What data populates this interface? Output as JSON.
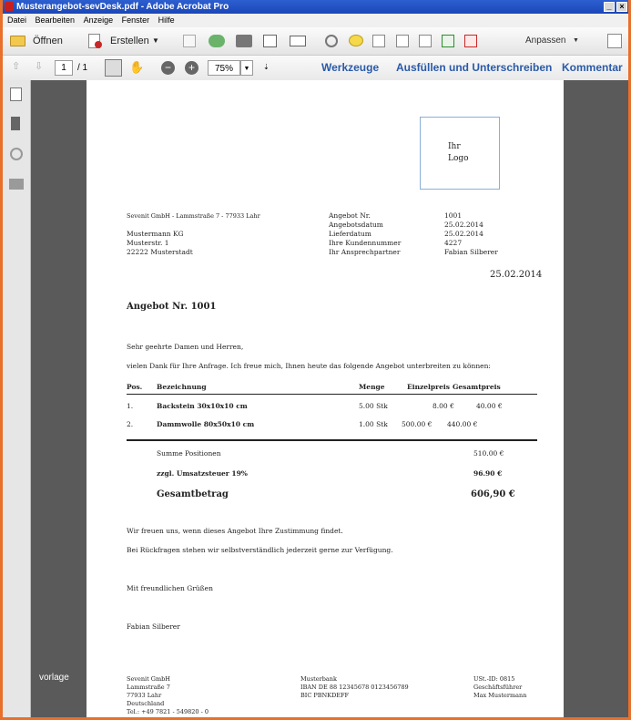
{
  "window": {
    "title": "Musterangebot-sevDesk.pdf - Adobe Acrobat Pro"
  },
  "menu": [
    "Datei",
    "Bearbeiten",
    "Anzeige",
    "Fenster",
    "Hilfe"
  ],
  "toolbar": {
    "open_label": "Öffnen",
    "create_label": "Erstellen",
    "customize_label": "Anpassen"
  },
  "nav": {
    "page_current": "1",
    "page_total": "/ 1",
    "zoom": "75%"
  },
  "panels": {
    "tools": "Werkzeuge",
    "fill_sign": "Ausfüllen und Unterschreiben",
    "comment": "Kommentar"
  },
  "doc": {
    "logo_line1": "Ihr",
    "logo_line2": "Logo",
    "sender_line": "Sevenit GmbH - Lammstraße 7 - 77933 Lahr",
    "recipient": [
      "Mustermann KG",
      "Musterstr. 1",
      "22222 Musterstadt"
    ],
    "meta_labels": [
      "Angebot Nr.",
      "Angebotsdatum",
      "Lieferdatum",
      "Ihre Kundennummer",
      "Ihr Ansprechpartner"
    ],
    "meta_values": [
      "1001",
      "25.02.2014",
      "25.02.2014",
      "4227",
      "Fabian Silberer"
    ],
    "date": "25.02.2014",
    "heading": "Angebot Nr. 1001",
    "greeting": "Sehr geehrte Damen und Herren,",
    "intro": "vielen Dank für Ihre Anfrage. Ich freue mich, Ihnen heute das folgende Angebot unterbreiten zu können:",
    "table_headers": {
      "pos": "Pos.",
      "desc": "Bezeichnung",
      "qty": "Menge",
      "unit": "Einzelpreis",
      "total": "Gesamtpreis"
    },
    "rows": [
      {
        "pos": "1.",
        "desc": "Backstein 30x10x10 cm",
        "qty": "5.00 Stk",
        "unit": "8.00 €",
        "total": "40.00 €"
      },
      {
        "pos": "2.",
        "desc": "Dammwolle 80x50x10 cm",
        "qty": "1.00 Stk",
        "unit": "500.00 €",
        "total": "440.00 €"
      }
    ],
    "sum_label": "Summe Positionen",
    "sum_value": "510.00 €",
    "vat_label": "zzgl. Umsatzsteuer 19%",
    "vat_value": "96.90 €",
    "grand_label": "Gesamtbetrag",
    "grand_value": "606,90 €",
    "closing1": "Wir freuen uns, wenn dieses Angebot Ihre Zustimmung findet.",
    "closing2": "Bei Rückfragen stehen wir selbstverständlich jederzeit gerne zur Verfügung.",
    "regards": "Mit freundlichen Grüßen",
    "signer": "Fabian Silberer",
    "footer_col1": [
      "Sevenit GmbH",
      "Lammstraße 7",
      "77933 Lahr",
      "Deutschland",
      "Tel.: +49 7821 - 549820 - 0"
    ],
    "footer_col2": [
      "Musterbank",
      "IBAN DE 88 12345678 0123456789",
      "BIC PBNKDEFF"
    ],
    "footer_col3": [
      "USt.-ID: 0815",
      "Geschäftsführer",
      "Max Mustermann"
    ]
  },
  "overlay_label": "vorlage",
  "colors": {
    "title_bar": "#1a47b8",
    "link": "#2a5aa8",
    "frame": "#e8702a",
    "workarea": "#5a5a5a"
  }
}
